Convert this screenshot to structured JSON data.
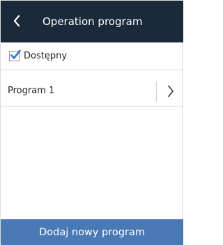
{
  "header": {
    "title": "Operation program",
    "back_icon": "chevron-left-icon"
  },
  "availability": {
    "label": "Dostępny",
    "checked": true,
    "check_color": "#2e75c9"
  },
  "programs": [
    {
      "label": "Program 1",
      "action_icon": "chevron-right-icon"
    }
  ],
  "footer": {
    "add_label": "Dodaj nowy program"
  },
  "colors": {
    "header_bg": "#1b2a3a",
    "button_bg": "#4a7ab5"
  }
}
